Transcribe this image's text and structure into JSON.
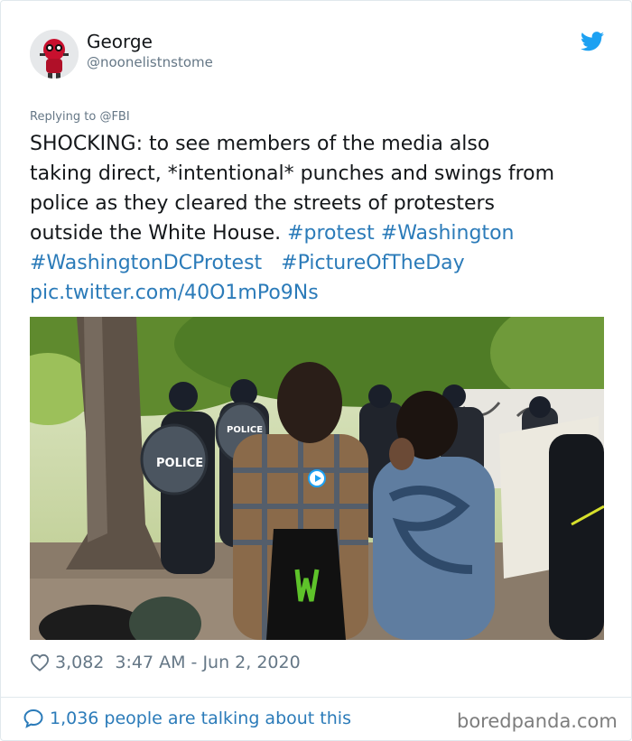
{
  "user": {
    "name": "George",
    "handle": "@noonelistnstome",
    "avatar_icon": "red-masked-character-avatar"
  },
  "reply": {
    "prefix": "Replying to ",
    "target": "@FBI"
  },
  "tweet": {
    "line1": "SHOCKING: to see members of the media also",
    "line2": "taking direct, *intentional* punches and swings from",
    "line3": "police as they cleared the streets of protesters",
    "line4_text": "outside the White House. ",
    "hashtags": [
      "#protest",
      "#Washington",
      "#WashingtonDCProtest",
      "#PictureOfTheDay"
    ],
    "link": "pic.twitter.com/40O1mPo9Ns"
  },
  "media": {
    "shields": [
      "POLICE",
      "POLICE"
    ],
    "play_icon": "video-play-icon"
  },
  "meta": {
    "likes": "3,082",
    "timestamp": "3:47 AM - Jun 2, 2020"
  },
  "footer": {
    "talking": "1,036 people are talking about this",
    "watermark": "boredpanda.com"
  },
  "colors": {
    "link_blue": "#2b7bb9",
    "twitter_blue": "#1da1f2",
    "secondary_gray": "#657786"
  }
}
